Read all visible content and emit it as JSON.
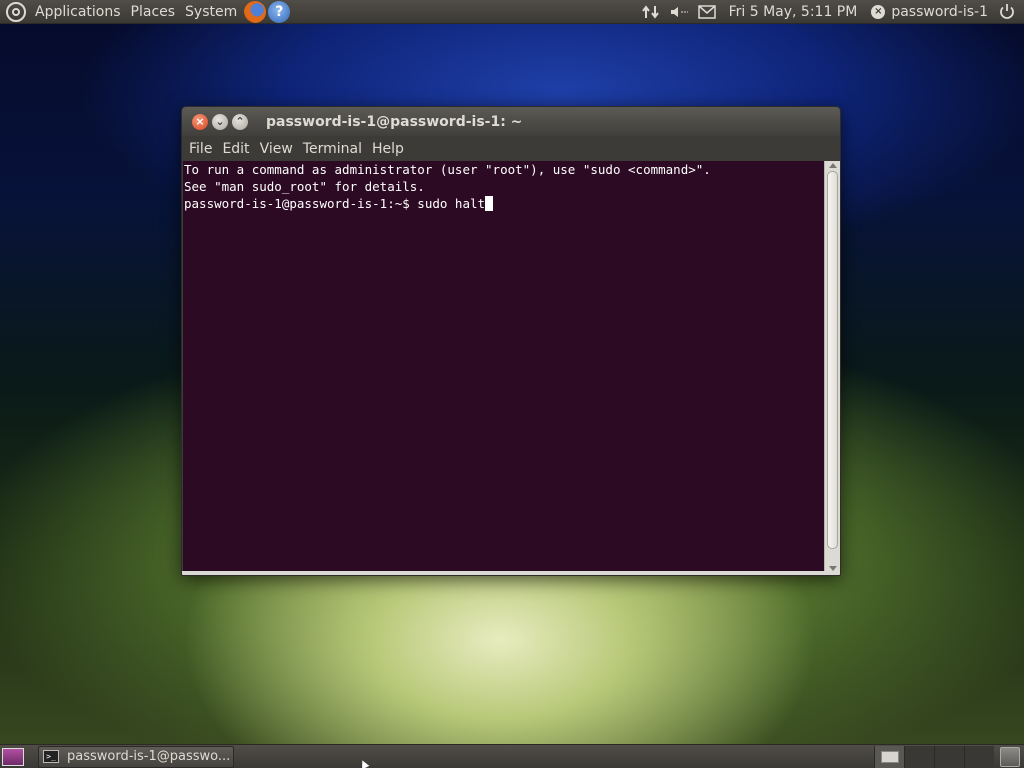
{
  "top_panel": {
    "menus": [
      "Applications",
      "Places",
      "System"
    ],
    "launchers": [
      "firefox-icon",
      "help-icon"
    ],
    "help_glyph": "?",
    "clock": "Fri  5 May,  5:11 PM",
    "user": "password-is-1",
    "tray_icons": [
      "network-icon",
      "volume-icon",
      "mail-icon"
    ]
  },
  "window": {
    "title": "password-is-1@password-is-1: ~",
    "menubar": [
      "File",
      "Edit",
      "View",
      "Terminal",
      "Help"
    ],
    "terminal_lines": [
      "To run a command as administrator (user \"root\"), use \"sudo <command>\".",
      "See \"man sudo_root\" for details.",
      ""
    ],
    "prompt": "password-is-1@password-is-1:~$ ",
    "command": "sudo halt"
  },
  "bottom_panel": {
    "task_label": "password-is-1@passwo...",
    "workspaces": 4
  },
  "colors": {
    "terminal_bg": "#2c0a23",
    "panel_bg": "#3b3935",
    "panel_text": "#dfdbd2"
  }
}
